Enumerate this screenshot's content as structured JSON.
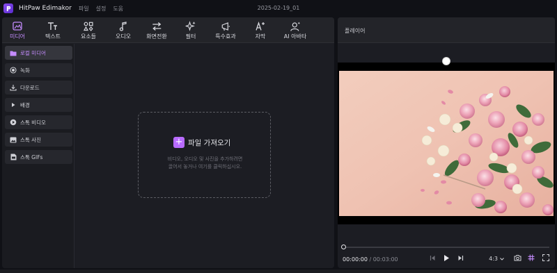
{
  "app": {
    "name": "HitPaw Edimakor",
    "menu": [
      "파일",
      "설정",
      "도움"
    ],
    "project_title": "2025-02-19_01",
    "accent_color": "#c58cff"
  },
  "toolbar": {
    "tabs": [
      {
        "label": "미디어",
        "icon": "media-icon",
        "active": true
      },
      {
        "label": "텍스트",
        "icon": "text-icon",
        "active": false
      },
      {
        "label": "요소들",
        "icon": "elements-icon",
        "active": false
      },
      {
        "label": "오디오",
        "icon": "audio-icon",
        "active": false
      },
      {
        "label": "화면전환",
        "icon": "transition-icon",
        "active": false
      },
      {
        "label": "필터",
        "icon": "filter-icon",
        "active": false
      },
      {
        "label": "특수효과",
        "icon": "effects-icon",
        "active": false
      },
      {
        "label": "자막",
        "icon": "subtitle-icon",
        "active": false
      },
      {
        "label": "AI 아바타",
        "icon": "ai-avatar-icon",
        "active": false
      }
    ]
  },
  "sidebar": {
    "items": [
      {
        "label": "로컬 미디어",
        "icon": "folder-icon",
        "active": true
      },
      {
        "label": "녹화",
        "icon": "record-icon",
        "active": false
      },
      {
        "label": "다운로드",
        "icon": "download-icon",
        "active": false
      },
      {
        "label": "배경",
        "icon": "background-icon",
        "active": false
      },
      {
        "label": "스톡 비디오",
        "icon": "stock-video-icon",
        "active": false
      },
      {
        "label": "스톡 사진",
        "icon": "stock-photo-icon",
        "active": false
      },
      {
        "label": "스톡 GIFs",
        "icon": "gif-icon",
        "active": false
      }
    ]
  },
  "import": {
    "button_label": "파일 가져오기",
    "description_line1": "비디오, 오디오 및 사진을 추가하려면",
    "description_line2": "끌어서 놓거나 여기를 클릭하십시오."
  },
  "player": {
    "title": "플레이어",
    "current_time": "00:00:00",
    "separator": " / ",
    "total_time": "00:03:00",
    "aspect_ratio": "4:3",
    "progress": 0
  }
}
